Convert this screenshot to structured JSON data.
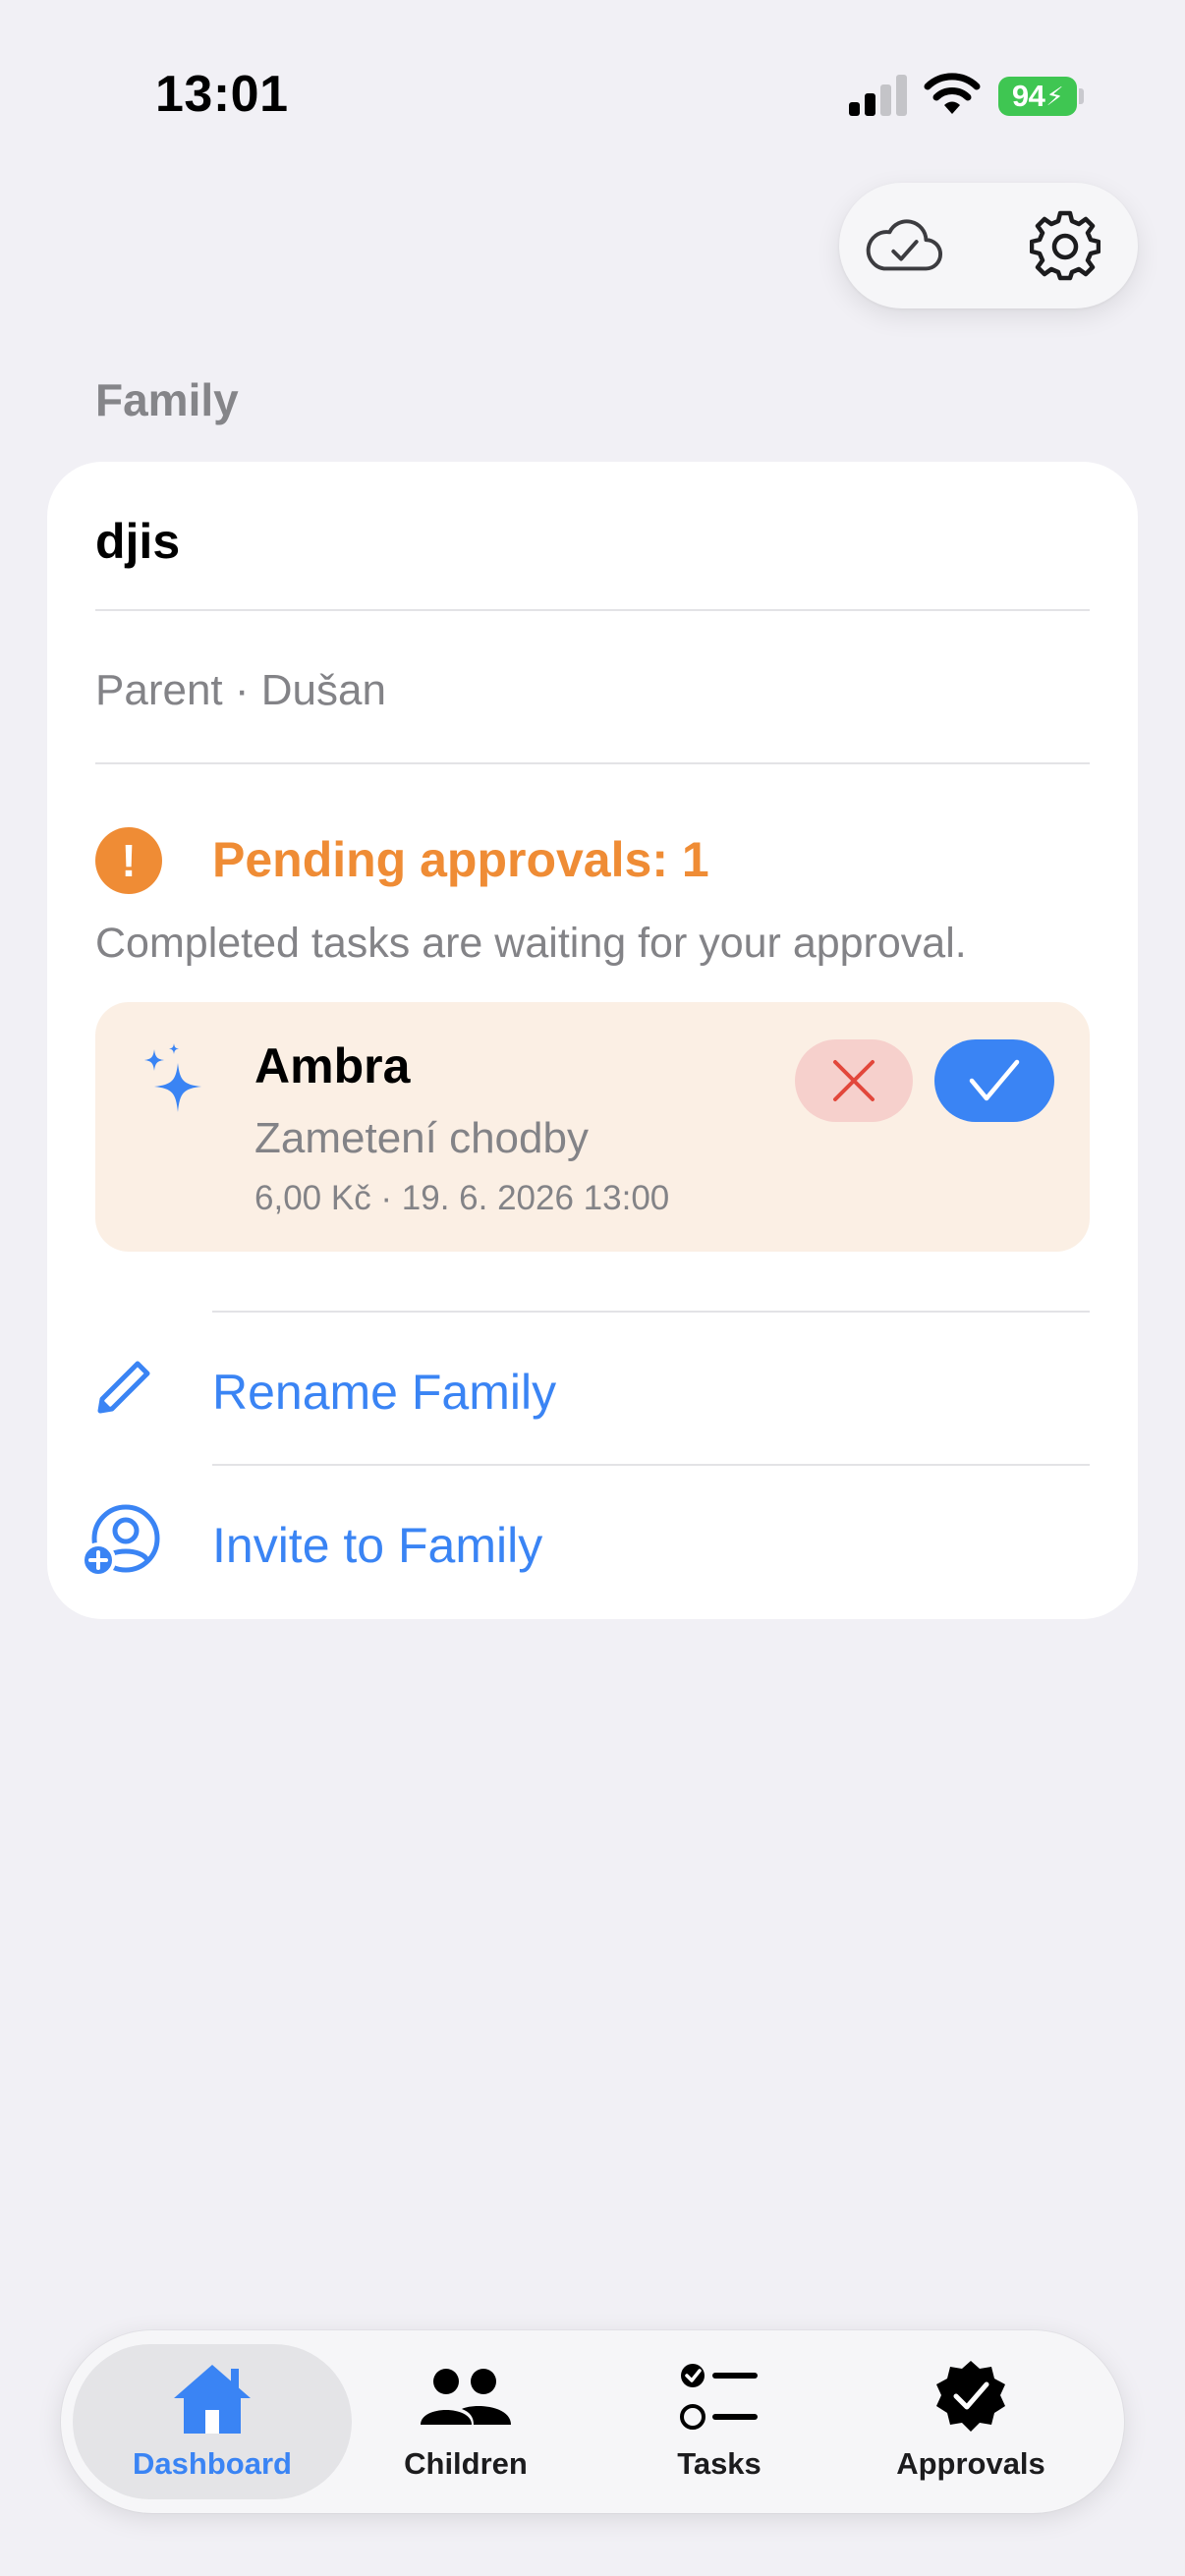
{
  "status_bar": {
    "time": "13:01",
    "battery": "94"
  },
  "top_actions": {
    "sync_icon": "cloud-check-icon",
    "settings_icon": "gear-icon"
  },
  "section": {
    "title": "Family"
  },
  "family": {
    "name": "djis",
    "role_line": "Parent · Dušan"
  },
  "pending": {
    "title": "Pending approvals: 1",
    "description": "Completed tasks are waiting for your approval.",
    "items": [
      {
        "child": "Ambra",
        "task": "Zametení chodby",
        "meta": "6,00 Kč · 19. 6. 2026 13:00"
      }
    ]
  },
  "actions": {
    "rename": "Rename Family",
    "invite": "Invite to Family"
  },
  "tabs": [
    {
      "label": "Dashboard",
      "icon": "house-icon",
      "active": true
    },
    {
      "label": "Children",
      "icon": "people-icon",
      "active": false
    },
    {
      "label": "Tasks",
      "icon": "checklist-icon",
      "active": false
    },
    {
      "label": "Approvals",
      "icon": "checkmark-seal-icon",
      "active": false
    }
  ],
  "colors": {
    "accent": "#3a84f4",
    "warning": "#ef8c35",
    "background": "#f1f0f5",
    "pending_item_bg": "#fbefe4",
    "reject_bg": "#f6d0cc",
    "reject_x": "#e2473b"
  }
}
